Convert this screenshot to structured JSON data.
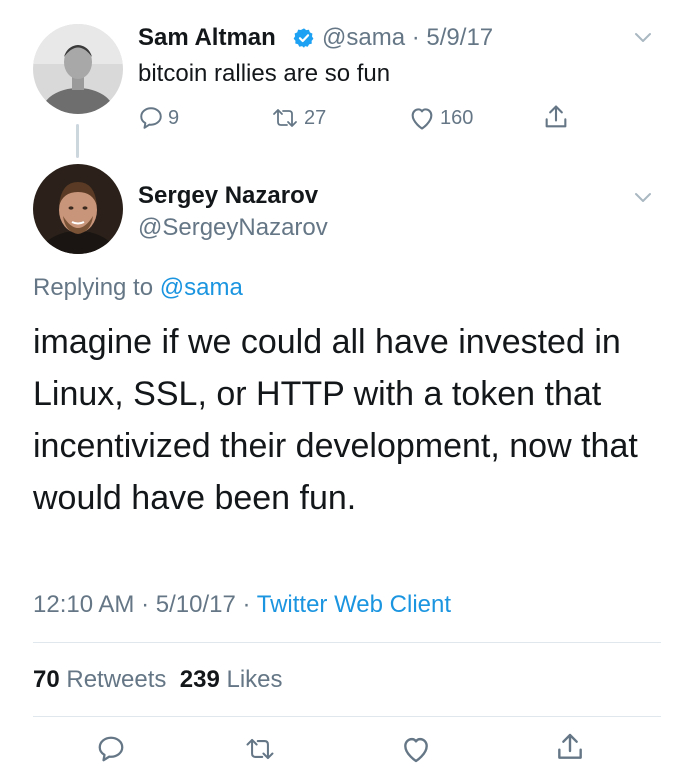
{
  "parent_tweet": {
    "author_name": "Sam Altman",
    "handle": "@sama",
    "separator": "·",
    "date": "5/9/17",
    "text": "bitcoin rallies are so fun",
    "replies_count": "9",
    "retweets_count": "27",
    "likes_count": "160"
  },
  "reply_tweet": {
    "author_name": "Sergey Nazarov",
    "handle": "@SergeyNazarov",
    "replying_prefix": "Replying to",
    "replying_to": "@sama",
    "text": "imagine if we could all have invested in Linux, SSL, or HTTP with a token that incentivized their development, now that would have been fun.",
    "time": "12:10 AM",
    "separator": "·",
    "date": "5/10/17",
    "client": "Twitter Web Client",
    "retweets_count": "70",
    "retweets_label": "Retweets",
    "likes_count": "239",
    "likes_label": "Likes"
  },
  "icons": {
    "verified": "verified-badge-icon",
    "chevron": "chevron-down-icon",
    "reply": "reply-icon",
    "retweet": "retweet-icon",
    "like": "heart-icon",
    "share": "share-icon"
  },
  "colors": {
    "text_primary": "#14171a",
    "text_secondary": "#657786",
    "link_blue": "#1b95e0",
    "verified_blue": "#1da1f2",
    "divider": "#e1e8ed",
    "thread_line": "#ccd6dd"
  }
}
